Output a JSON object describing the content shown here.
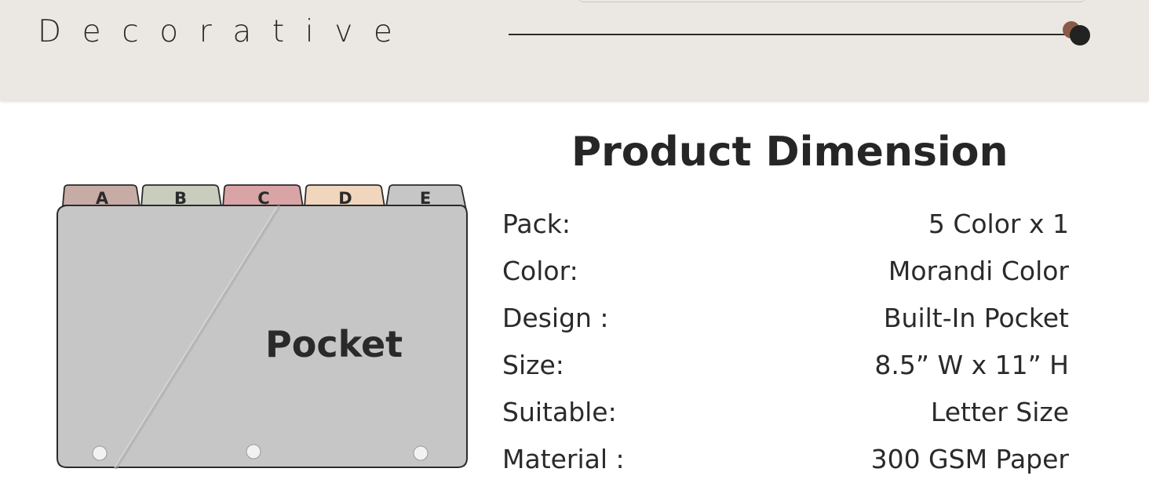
{
  "header": {
    "word": "Decorative",
    "dot_accent_color": "#8a5a46",
    "dot_main_color": "#222222",
    "background": "#ebe8e4"
  },
  "divider": {
    "tabs": [
      {
        "letter": "A",
        "color": "#c7aca5"
      },
      {
        "letter": "B",
        "color": "#c8cdbd"
      },
      {
        "letter": "C",
        "color": "#d9a4a6"
      },
      {
        "letter": "D",
        "color": "#efd6bd"
      },
      {
        "letter": "E",
        "color": "#c6c6c6"
      }
    ],
    "pocket_label": "Pocket",
    "body_color": "#c6c6c6"
  },
  "specs": {
    "title": "Product Dimension",
    "rows": [
      {
        "label": "Pack:",
        "value": "5 Color x 1"
      },
      {
        "label": "Color:",
        "value": "Morandi Color"
      },
      {
        "label": "Design :",
        "value": "Built-In Pocket"
      },
      {
        "label": "Size:",
        "value": "8.5” W x 11” H"
      },
      {
        "label": "Suitable:",
        "value": "Letter Size"
      },
      {
        "label": "Material :",
        "value": "300 GSM Paper"
      }
    ]
  }
}
